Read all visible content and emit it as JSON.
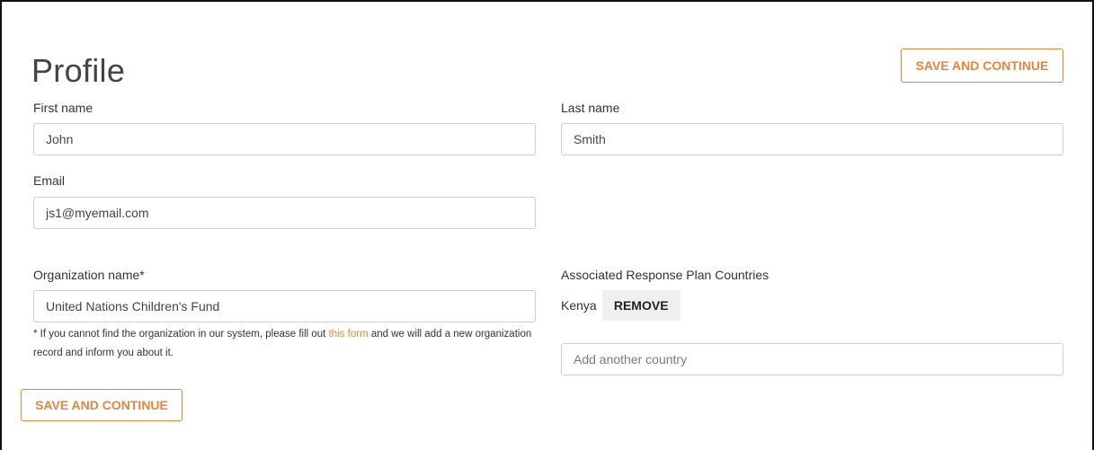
{
  "page": {
    "title": "Profile"
  },
  "header": {
    "save_label": "SAVE AND CONTINUE"
  },
  "form": {
    "first_name": {
      "label": "First name",
      "value": "John"
    },
    "last_name": {
      "label": "Last name",
      "value": "Smith"
    },
    "email": {
      "label": "Email",
      "value": "js1@myemail.com"
    },
    "organization": {
      "label": "Organization name*",
      "value": "United Nations Children's Fund",
      "help_before": "* If you cannot find the organization in our system, please fill out ",
      "help_link": "this form",
      "help_after": " and we will add a new organization record and inform you about it."
    },
    "countries": {
      "label": "Associated Response Plan Countries",
      "items": [
        {
          "name": "Kenya",
          "remove_label": "REMOVE"
        }
      ],
      "add_placeholder": "Add another country"
    }
  },
  "footer": {
    "save_label": "SAVE AND CONTINUE"
  },
  "colors": {
    "accent": "#e8843c",
    "border": "#cfcfcf",
    "remove_bg": "#efefef"
  }
}
